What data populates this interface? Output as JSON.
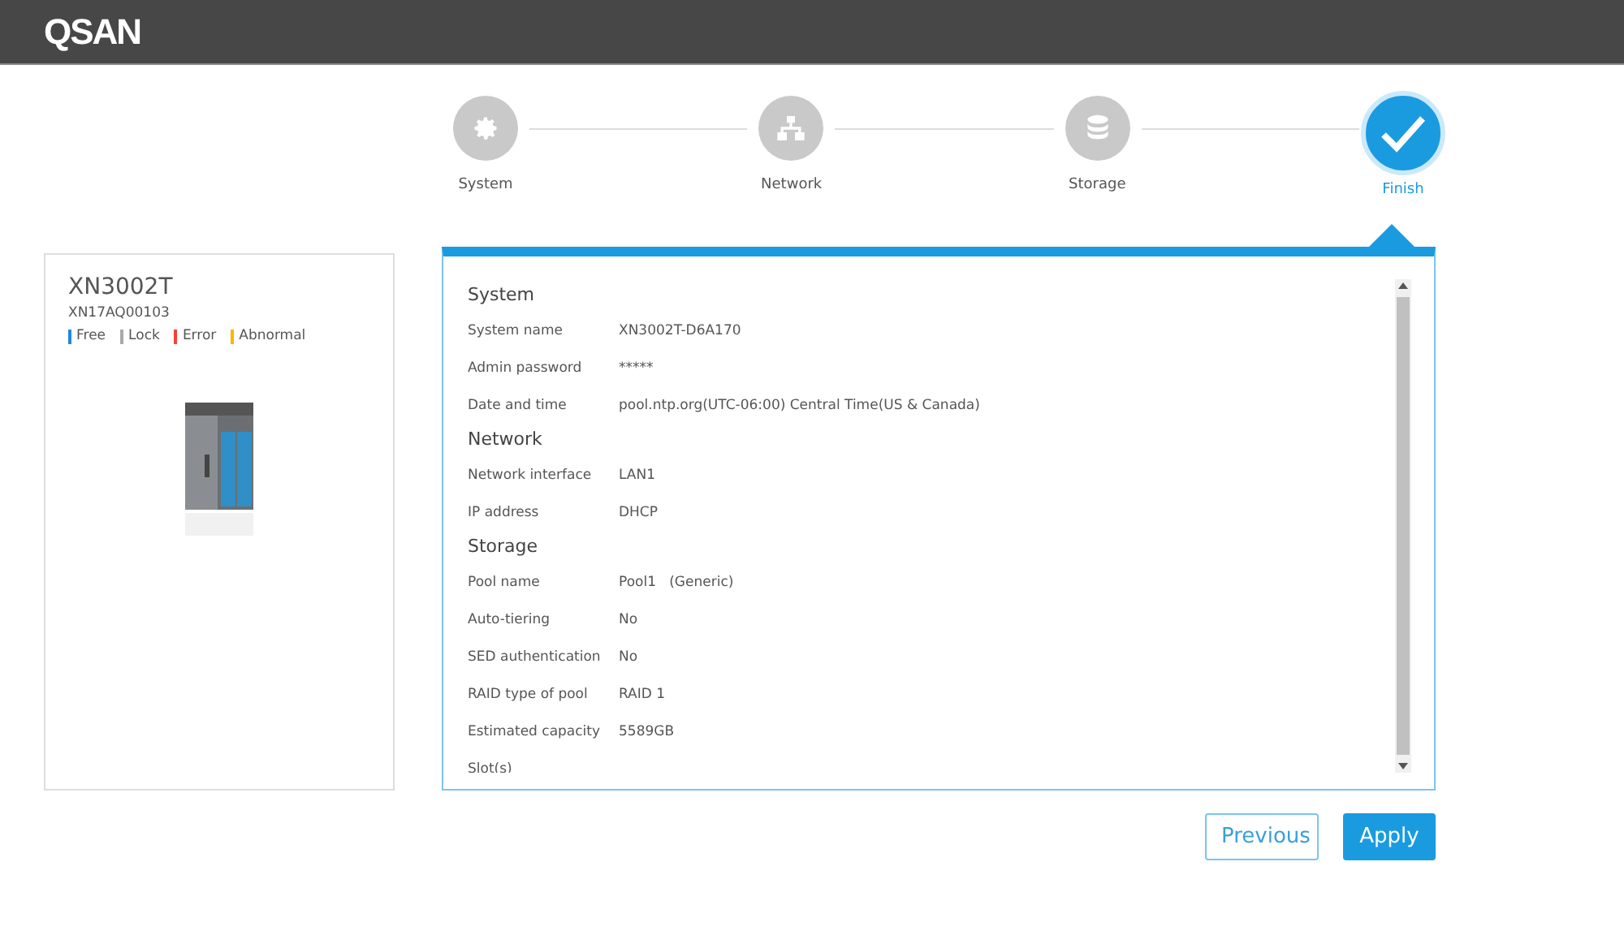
{
  "header": {
    "logo": "QSAN"
  },
  "steps": [
    {
      "label": "System",
      "kind": "gear",
      "selected": false
    },
    {
      "label": "Network",
      "kind": "network",
      "selected": false
    },
    {
      "label": "Storage",
      "kind": "database",
      "selected": false
    },
    {
      "label": "Finish",
      "kind": "check",
      "selected": true
    }
  ],
  "device": {
    "model": "XN3002T",
    "serial": "XN17AQ00103",
    "legend": [
      {
        "label": "Free",
        "color": "#1e88e5"
      },
      {
        "label": "Lock",
        "color": "#aaaaaa"
      },
      {
        "label": "Error",
        "color": "#f44336"
      },
      {
        "label": "Abnormal",
        "color": "#ffb300"
      }
    ]
  },
  "summary": [
    {
      "title": "System",
      "rows": [
        {
          "label": "System name",
          "value": "XN3002T-D6A170"
        },
        {
          "label": "Admin password",
          "value": "*****"
        },
        {
          "label": "Date and time",
          "value": "pool.ntp.org(UTC-06:00) Central Time(US & Canada)"
        }
      ]
    },
    {
      "title": "Network",
      "rows": [
        {
          "label": "Network interface",
          "value": "LAN1"
        },
        {
          "label": "IP address",
          "value": "DHCP"
        }
      ]
    },
    {
      "title": "Storage",
      "rows": [
        {
          "label": "Pool name",
          "value": "Pool1   (Generic)"
        },
        {
          "label": "Auto-tiering",
          "value": "No"
        },
        {
          "label": "SED authentication",
          "value": "No"
        },
        {
          "label": "RAID type of pool",
          "value": "RAID 1"
        },
        {
          "label": "Estimated capacity",
          "value": "5589GB"
        },
        {
          "label": "Slot(s)"
        }
      ]
    }
  ],
  "buttons": [
    {
      "label": "Previous",
      "kind": "secondary"
    },
    {
      "label": "Apply",
      "kind": "primary"
    }
  ]
}
